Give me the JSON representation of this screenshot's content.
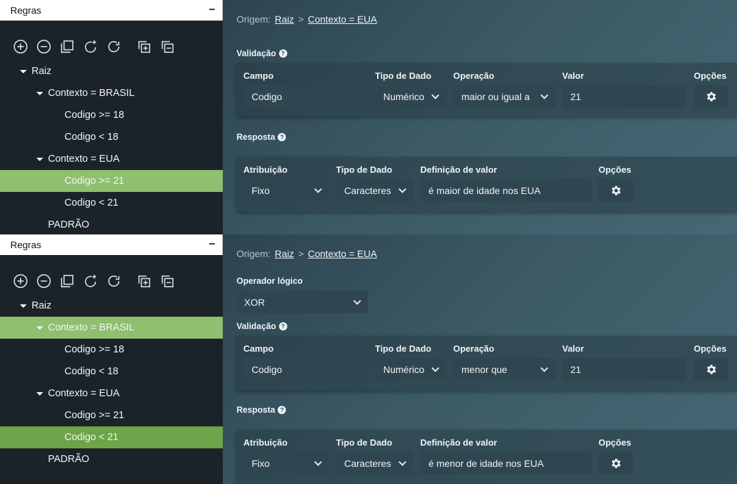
{
  "panels": [
    {
      "sidebar": {
        "title": "Regras",
        "minimize": "−",
        "tree": [
          {
            "label": "Raiz"
          },
          {
            "label": "Contexto = BRASIL"
          },
          {
            "label": "Codigo >= 18"
          },
          {
            "label": "Codigo < 18"
          },
          {
            "label": "Contexto = EUA"
          },
          {
            "label": "Codigo >= 21"
          },
          {
            "label": "Codigo < 21"
          },
          {
            "label": "PADRÃO"
          }
        ]
      },
      "breadcrumb": {
        "prefix": "Origem:",
        "root": "Raiz",
        "sep": ">",
        "current": "Contexto = EUA"
      },
      "validacao": {
        "title": "Validação",
        "headers": {
          "campo": "Campo",
          "tipo": "Tipo de Dado",
          "operacao": "Operação",
          "valor": "Valor",
          "opcoes": "Opções"
        },
        "campo": "Codigo",
        "tipo": "Numérico",
        "operacao": "maior ou igual a",
        "valor": "21"
      },
      "resposta": {
        "title": "Resposta",
        "headers": {
          "atribuicao": "Atribuição",
          "tipo": "Tipo de Dado",
          "definicao": "Definição de valor",
          "opcoes": "Opções"
        },
        "atribuicao": "Fixo",
        "tipo": "Caracteres",
        "definicao": "é maior de idade nos EUA"
      }
    },
    {
      "sidebar": {
        "title": "Regras",
        "minimize": "−",
        "tree": [
          {
            "label": "Raiz"
          },
          {
            "label": "Contexto = BRASIL"
          },
          {
            "label": "Codigo >= 18"
          },
          {
            "label": "Codigo < 18"
          },
          {
            "label": "Contexto = EUA"
          },
          {
            "label": "Codigo >= 21"
          },
          {
            "label": "Codigo < 21"
          },
          {
            "label": "PADRÃO"
          }
        ]
      },
      "breadcrumb": {
        "prefix": "Origem:",
        "root": "Raiz",
        "sep": ">",
        "current": "Contexto = EUA"
      },
      "operador": {
        "title": "Operador lógico",
        "value": "XOR"
      },
      "validacao": {
        "title": "Validação",
        "headers": {
          "campo": "Campo",
          "tipo": "Tipo de Dado",
          "operacao": "Operação",
          "valor": "Valor",
          "opcoes": "Opções"
        },
        "campo": "Codigo",
        "tipo": "Numérico",
        "operacao": "menor que",
        "valor": "21"
      },
      "resposta": {
        "title": "Resposta",
        "headers": {
          "atribuicao": "Atribuição",
          "tipo": "Tipo de Dado",
          "definicao": "Definição de valor",
          "opcoes": "Opções"
        },
        "atribuicao": "Fixo",
        "tipo": "Caracteres",
        "definicao": "é menor de idade nos EUA"
      }
    }
  ],
  "colors": {
    "selected_light": "#8fbf6f",
    "selected_dark": "#6ea449",
    "sidebar_bg": "#1b2329"
  }
}
